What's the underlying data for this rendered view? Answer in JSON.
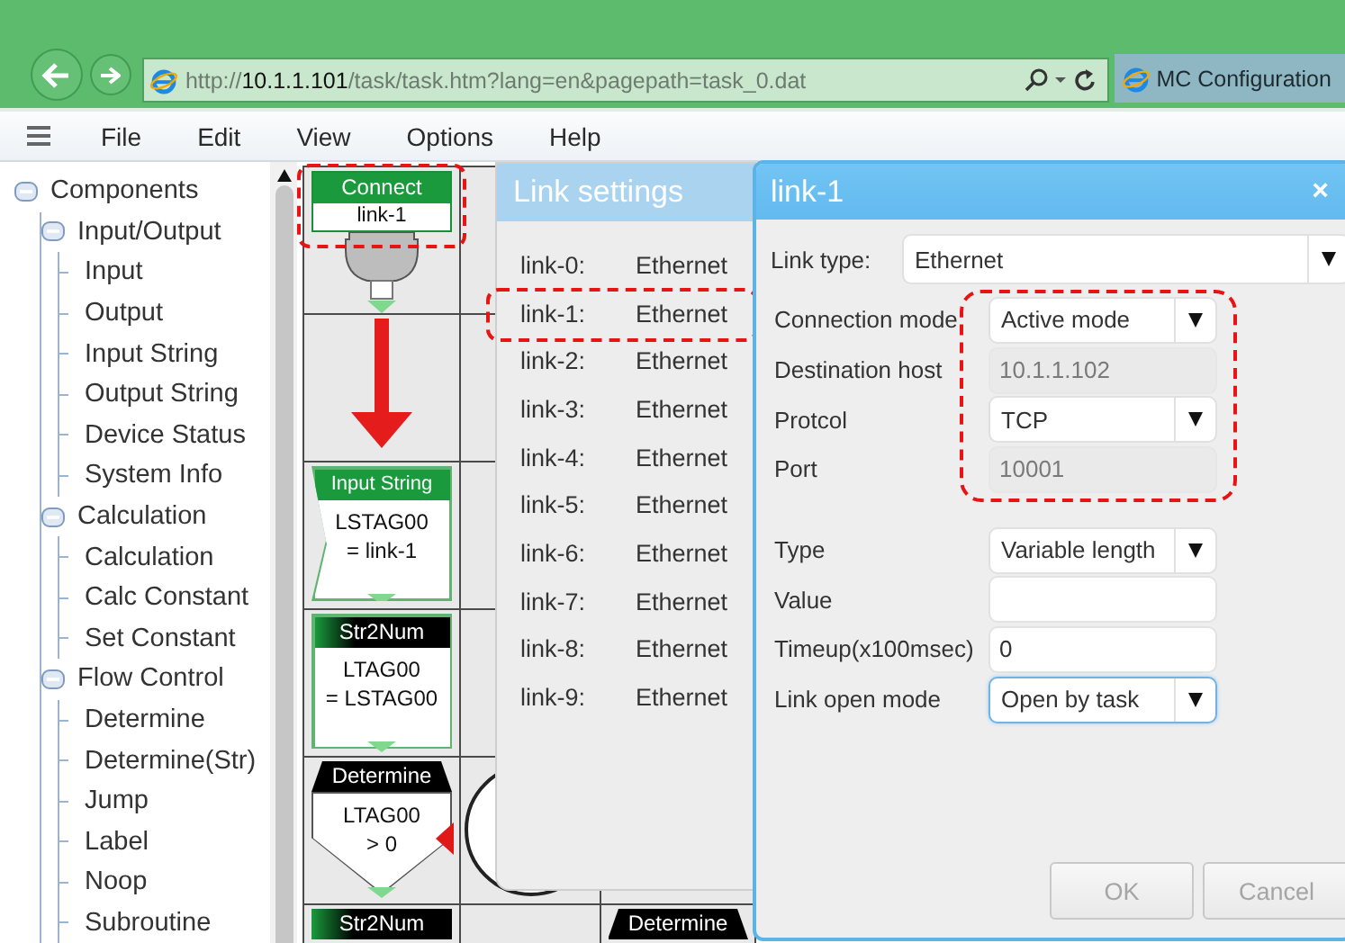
{
  "browser": {
    "address": {
      "prefix": "http://",
      "host": "10.1.1.101",
      "path": "/task/task.htm?lang=en&pagepath=task_0.dat"
    },
    "tab_title": "MC Configuration"
  },
  "menu": [
    "File",
    "Edit",
    "View",
    "Options",
    "Help"
  ],
  "tree": [
    {
      "label": "Components",
      "expanded": true,
      "children": [
        {
          "label": "Input/Output",
          "expanded": true,
          "children": [
            {
              "label": "Input"
            },
            {
              "label": "Output"
            },
            {
              "label": "Input String"
            },
            {
              "label": "Output String"
            },
            {
              "label": "Device Status"
            },
            {
              "label": "System Info"
            }
          ]
        },
        {
          "label": "Calculation",
          "expanded": true,
          "children": [
            {
              "label": "Calculation"
            },
            {
              "label": "Calc Constant"
            },
            {
              "label": "Set Constant"
            }
          ]
        },
        {
          "label": "Flow Control",
          "expanded": true,
          "children": [
            {
              "label": "Determine"
            },
            {
              "label": "Determine(Str)"
            },
            {
              "label": "Jump"
            },
            {
              "label": "Label"
            },
            {
              "label": "Noop"
            },
            {
              "label": "Subroutine"
            }
          ]
        }
      ]
    }
  ],
  "flow": {
    "rows": [
      [
        {
          "kind": "connect",
          "title": "Connect",
          "lines": [
            "link-1"
          ],
          "highlighted": true
        },
        {
          "kind": "empty"
        },
        {
          "kind": "empty"
        }
      ],
      [
        {
          "kind": "arrow"
        },
        {
          "kind": "empty"
        },
        {
          "kind": "empty"
        }
      ],
      [
        {
          "kind": "input",
          "title": "Input String",
          "lines": [
            "LSTAG00",
            "= link-1"
          ]
        },
        {
          "kind": "empty"
        },
        {
          "kind": "empty"
        }
      ],
      [
        {
          "kind": "convert",
          "title": "Str2Num",
          "lines": [
            "LTAG00",
            "= LSTAG00"
          ]
        },
        {
          "kind": "empty"
        },
        {
          "kind": "empty"
        }
      ],
      [
        {
          "kind": "determine",
          "title": "Determine",
          "lines": [
            "LTAG00",
            "> 0"
          ]
        },
        {
          "kind": "circle"
        },
        {
          "kind": "empty"
        }
      ],
      [
        {
          "kind": "convert",
          "title": "Str2Num"
        },
        {
          "kind": "empty"
        },
        {
          "kind": "determine",
          "title": "Determine"
        }
      ]
    ]
  },
  "link_list": {
    "title": "Link settings",
    "rows": [
      {
        "name": "link-0:",
        "type": "Ethernet"
      },
      {
        "name": "link-1:",
        "type": "Ethernet",
        "highlighted": true
      },
      {
        "name": "link-2:",
        "type": "Ethernet"
      },
      {
        "name": "link-3:",
        "type": "Ethernet"
      },
      {
        "name": "link-4:",
        "type": "Ethernet"
      },
      {
        "name": "link-5:",
        "type": "Ethernet"
      },
      {
        "name": "link-6:",
        "type": "Ethernet"
      },
      {
        "name": "link-7:",
        "type": "Ethernet"
      },
      {
        "name": "link-8:",
        "type": "Ethernet"
      },
      {
        "name": "link-9:",
        "type": "Ethernet"
      }
    ]
  },
  "dialog": {
    "title": "link-1",
    "close": "×",
    "link_type": {
      "label": "Link type:",
      "value": "Ethernet"
    },
    "groups": [
      {
        "highlighted": true,
        "fields": [
          {
            "kind": "select",
            "label": "Connection mode",
            "value": "Active mode",
            "disabled": false,
            "focused": false
          },
          {
            "kind": "text",
            "label": "Destination host",
            "value": "10.1.1.102",
            "disabled": true,
            "focused": false
          },
          {
            "kind": "select",
            "label": "Protcol",
            "value": "TCP",
            "disabled": false,
            "focused": false
          },
          {
            "kind": "text",
            "label": "Port",
            "value": "10001",
            "disabled": true,
            "focused": false
          }
        ]
      },
      {
        "fields": [
          {
            "kind": "select",
            "label": "Type",
            "value": "Variable length",
            "disabled": false,
            "focused": false
          },
          {
            "kind": "text",
            "label": "Value",
            "disabled": false,
            "focused": false
          },
          {
            "kind": "text",
            "label": "Timeup(x100msec)",
            "value": "0",
            "disabled": false,
            "focused": false
          },
          {
            "kind": "select",
            "label": "Link open mode",
            "value": "Open by task",
            "disabled": false,
            "focused": true
          }
        ]
      }
    ],
    "buttons": [
      {
        "label": "OK",
        "disabled": true
      },
      {
        "label": "Cancel",
        "disabled": true
      }
    ]
  }
}
